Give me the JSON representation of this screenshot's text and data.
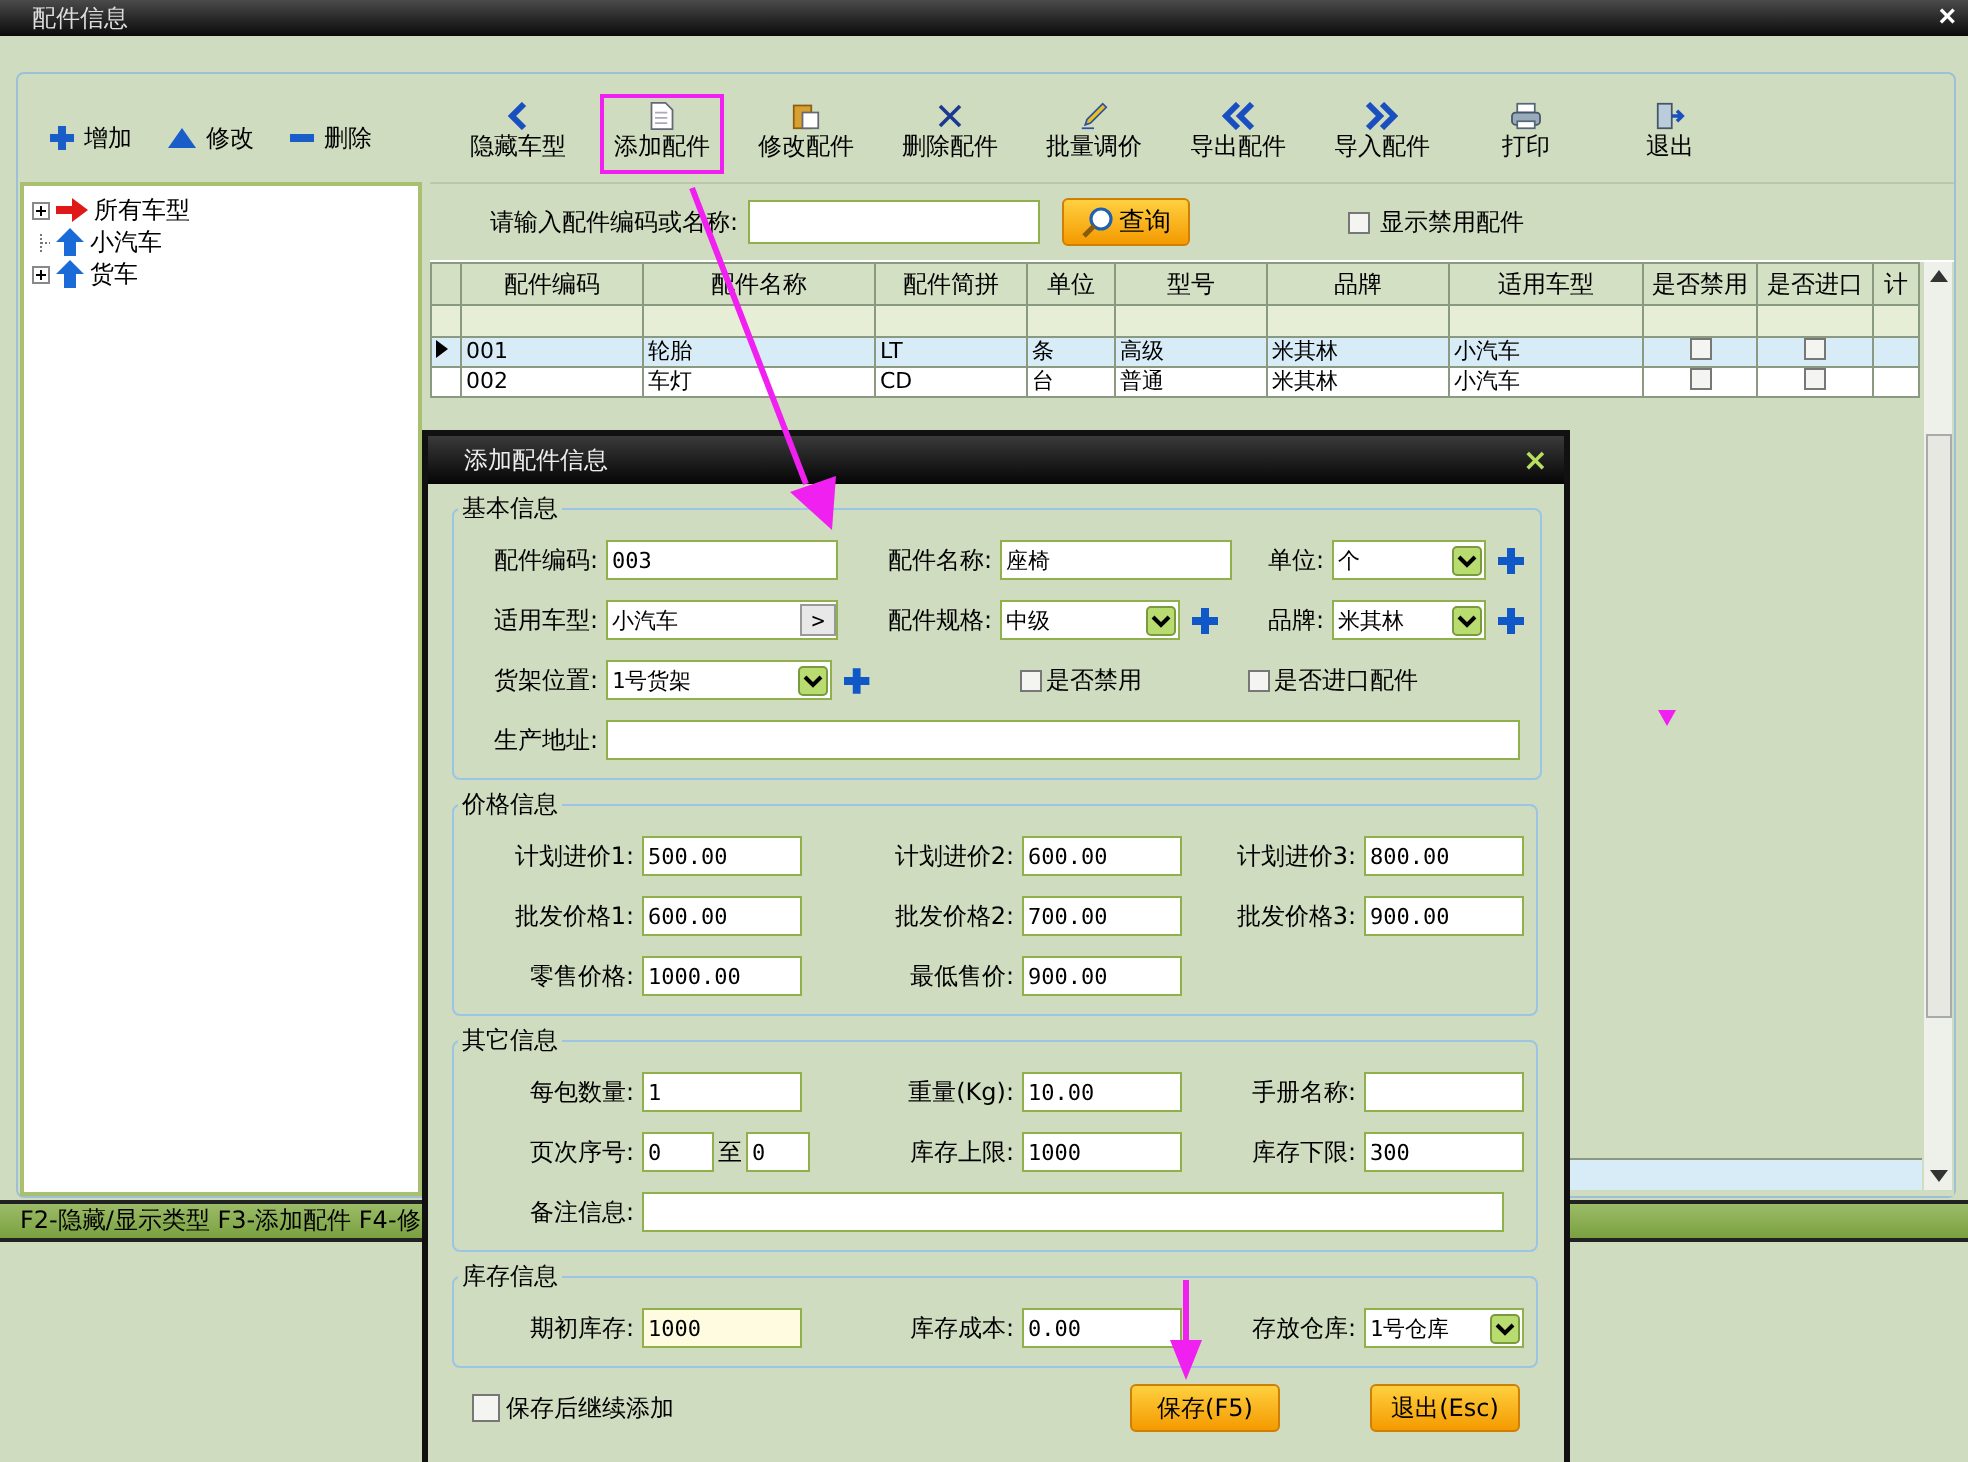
{
  "window": {
    "title": "配件信息",
    "close": "×"
  },
  "side_buttons": [
    "增加",
    "修改",
    "删除"
  ],
  "tree": [
    {
      "label": "所有车型",
      "selected": true,
      "expandable": true
    },
    {
      "label": "小汽车",
      "selected": false,
      "expandable": false
    },
    {
      "label": "货车",
      "selected": false,
      "expandable": true
    }
  ],
  "toolbar": [
    {
      "label": "隐藏车型",
      "highlighted": false
    },
    {
      "label": "添加配件",
      "highlighted": true
    },
    {
      "label": "修改配件",
      "highlighted": false
    },
    {
      "label": "删除配件",
      "highlighted": false
    },
    {
      "label": "批量调价",
      "highlighted": false
    },
    {
      "label": "导出配件",
      "highlighted": false
    },
    {
      "label": "导入配件",
      "highlighted": false
    },
    {
      "label": "打印",
      "highlighted": false
    },
    {
      "label": "退出",
      "highlighted": false
    }
  ],
  "search": {
    "label": "请输入配件编码或名称:",
    "button": "查询",
    "show_disabled": {
      "label": "显示禁用配件",
      "checked": false
    }
  },
  "table": {
    "columns": [
      "配件编码",
      "配件名称",
      "配件简拼",
      "单位",
      "型号",
      "品牌",
      "适用车型",
      "是否禁用",
      "是否进口",
      "计"
    ],
    "rows": [
      {
        "selected": true,
        "cells": [
          "001",
          "轮胎",
          "LT",
          "条",
          "高级",
          "米其林",
          "小汽车"
        ],
        "disabled": false,
        "imported": false
      },
      {
        "selected": false,
        "cells": [
          "002",
          "车灯",
          "CD",
          "台",
          "普通",
          "米其林",
          "小汽车"
        ],
        "disabled": false,
        "imported": false
      }
    ]
  },
  "status_bar": "F2-隐藏/显示类型  F3-添加配件 F4-修",
  "dialog": {
    "title": "添加配件信息",
    "close": "×",
    "sections": [
      {
        "title": "基本信息",
        "rows": [
          [
            {
              "kind": "text",
              "label": "配件编码:",
              "value": "003"
            },
            {
              "kind": "text",
              "label": "配件名称:",
              "value": "座椅"
            },
            {
              "kind": "select",
              "label": "单位:",
              "value": "个",
              "add": true
            }
          ],
          [
            {
              "kind": "picker",
              "label": "适用车型:",
              "value": "小汽车",
              "button": ">"
            },
            {
              "kind": "select",
              "label": "配件规格:",
              "value": "中级",
              "add": true
            },
            {
              "kind": "select",
              "label": "品牌:",
              "value": "米其林",
              "add": true
            }
          ],
          [
            {
              "kind": "select",
              "label": "货架位置:",
              "value": "1号货架",
              "add": true
            },
            {
              "kind": "checkbox",
              "label": "是否禁用",
              "checked": false
            },
            {
              "kind": "checkbox",
              "label": "是否进口配件",
              "checked": false
            }
          ],
          [
            {
              "kind": "wide",
              "label": "生产地址:"
            }
          ]
        ]
      },
      {
        "title": "价格信息",
        "rows": [
          [
            {
              "kind": "text",
              "label": "计划进价1:",
              "value": "500.00"
            },
            {
              "kind": "text",
              "label": "计划进价2:",
              "value": "600.00"
            },
            {
              "kind": "text",
              "label": "计划进价3:",
              "value": "800.00"
            }
          ],
          [
            {
              "kind": "text",
              "label": "批发价格1:",
              "value": "600.00"
            },
            {
              "kind": "text",
              "label": "批发价格2:",
              "value": "700.00"
            },
            {
              "kind": "text",
              "label": "批发价格3:",
              "value": "900.00"
            }
          ],
          [
            {
              "kind": "text",
              "label": "零售价格:",
              "value": "1000.00"
            },
            {
              "kind": "text",
              "label": "最低售价:",
              "value": "900.00"
            }
          ]
        ]
      },
      {
        "title": "其它信息",
        "rows": [
          [
            {
              "kind": "text",
              "label": "每包数量:",
              "value": "1"
            },
            {
              "kind": "text",
              "label": "重量(Kg):",
              "value": "10.00"
            },
            {
              "kind": "text",
              "label": "手册名称:"
            }
          ],
          [
            {
              "kind": "range",
              "label": "页次序号:",
              "from": "0",
              "separator": "至",
              "to": "0"
            },
            {
              "kind": "text",
              "label": "库存上限:",
              "value": "1000"
            },
            {
              "kind": "text",
              "label": "库存下限:",
              "value": "300"
            }
          ],
          [
            {
              "kind": "wide",
              "label": "备注信息:"
            }
          ]
        ]
      },
      {
        "title": "库存信息",
        "rows": [
          [
            {
              "kind": "text",
              "label": "期初库存:",
              "value": "1000",
              "focused": true
            },
            {
              "kind": "text",
              "label": "库存成本:",
              "value": "0.00"
            },
            {
              "kind": "select",
              "label": "存放仓库:",
              "value": "1号仓库",
              "add": false
            }
          ]
        ]
      }
    ],
    "continue_option": {
      "label": "保存后继续添加",
      "checked": false
    },
    "buttons": [
      "保存(F5)",
      "退出(Esc)"
    ]
  }
}
